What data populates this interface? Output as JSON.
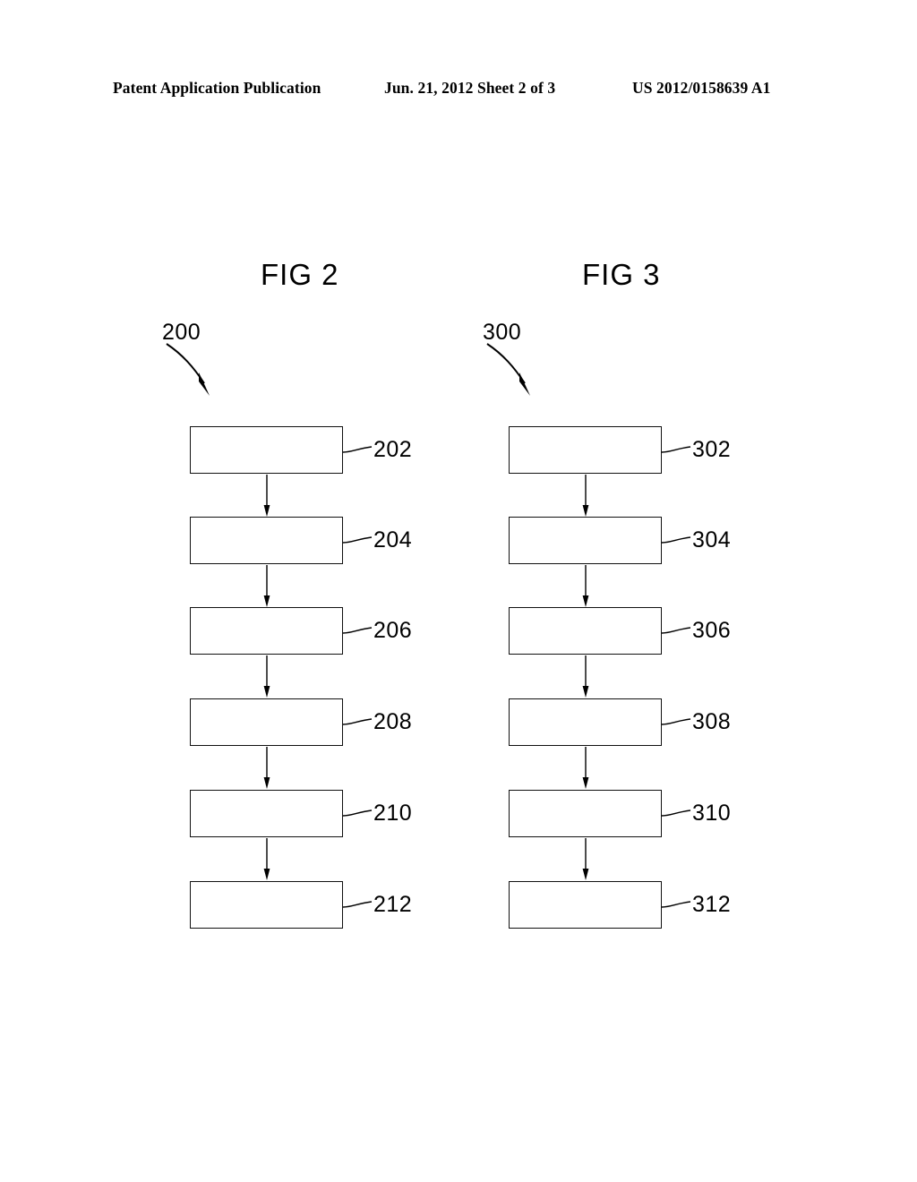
{
  "header": {
    "publication": "Patent Application Publication",
    "date_sheet": "Jun. 21, 2012  Sheet 2 of 3",
    "document_number": "US 2012/0158639 A1"
  },
  "colors": {
    "page_background": "#ffffff",
    "ink": "#000000",
    "box_stroke": "#111111"
  },
  "figures": [
    {
      "title": "FIG 2",
      "reference_label": "200",
      "boxes": [
        {
          "ref": "202"
        },
        {
          "ref": "204"
        },
        {
          "ref": "206"
        },
        {
          "ref": "208"
        },
        {
          "ref": "210"
        },
        {
          "ref": "212"
        }
      ]
    },
    {
      "title": "FIG 3",
      "reference_label": "300",
      "boxes": [
        {
          "ref": "302"
        },
        {
          "ref": "304"
        },
        {
          "ref": "306"
        },
        {
          "ref": "308"
        },
        {
          "ref": "310"
        },
        {
          "ref": "312"
        }
      ]
    }
  ]
}
